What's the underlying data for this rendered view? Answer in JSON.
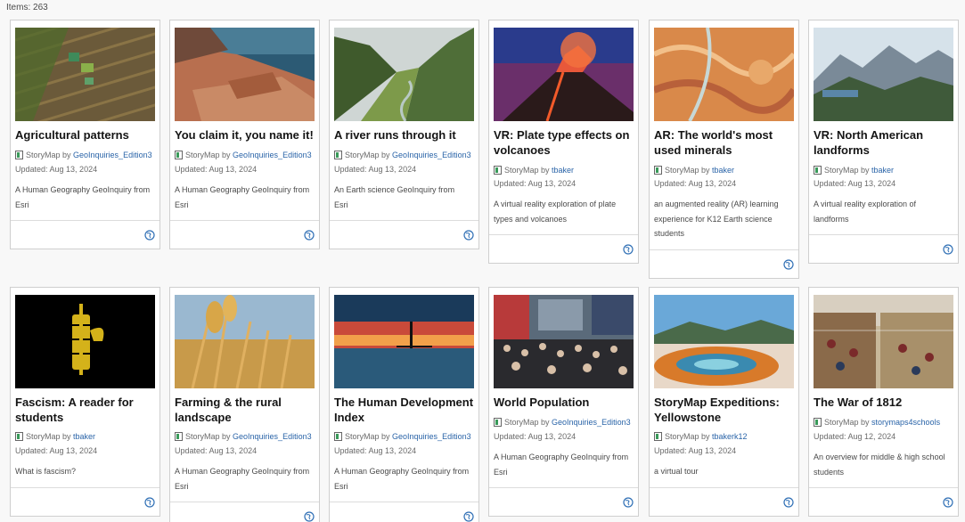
{
  "header": {
    "items_count": "Items: 263"
  },
  "labels": {
    "type_label": "StoryMap by "
  },
  "icons": {
    "storymap": "storymap-icon",
    "share": "globe-share-icon"
  },
  "colors": {
    "owner_link": "#2a64a8",
    "card_border": "#cfcfcf",
    "share_icon": "#2f6fb5"
  },
  "cards": [
    {
      "title": "Agricultural patterns",
      "owner": "GeoInquiries_Edition3",
      "updated": "Updated: Aug 13, 2024",
      "description": "A Human Geography GeoInquiry from Esri"
    },
    {
      "title": "You claim it, you name it!",
      "owner": "GeoInquiries_Edition3",
      "updated": "Updated: Aug 13, 2024",
      "description": "A Human Geography GeoInquiry from Esri"
    },
    {
      "title": "A river runs through it",
      "owner": "GeoInquiries_Edition3",
      "updated": "Updated: Aug 13, 2024",
      "description": "An Earth science GeoInquiry from Esri"
    },
    {
      "title": "VR: Plate type effects on volcanoes",
      "owner": "tbaker",
      "updated": "Updated: Aug 13, 2024",
      "description": "A virtual reality exploration of plate types and volcanoes"
    },
    {
      "title": "AR: The world's most used minerals",
      "owner": "tbaker",
      "updated": "Updated: Aug 13, 2024",
      "description": "an augmented reality (AR) learning experience for K12 Earth science students"
    },
    {
      "title": "VR: North American landforms",
      "owner": "tbaker",
      "updated": "Updated: Aug 13, 2024",
      "description": "A virtual reality exploration of landforms"
    },
    {
      "title": "Fascism: A reader for students",
      "owner": "tbaker",
      "updated": "Updated: Aug 13, 2024",
      "description": "What is fascism?"
    },
    {
      "title": "Farming & the rural landscape",
      "owner": "GeoInquiries_Edition3",
      "updated": "Updated: Aug 13, 2024",
      "description": "A Human Geography GeoInquiry from Esri"
    },
    {
      "title": "The Human Development Index",
      "owner": "GeoInquiries_Edition3",
      "updated": "Updated: Aug 13, 2024",
      "description": "A Human Geography GeoInquiry from Esri"
    },
    {
      "title": "World Population",
      "owner": "GeoInquiries_Edition3",
      "updated": "Updated: Aug 13, 2024",
      "description": "A Human Geography GeoInquiry from Esri"
    },
    {
      "title": "StoryMap Expeditions: Yellowstone",
      "owner": "tbakerk12",
      "updated": "Updated: Aug 13, 2024",
      "description": "a virtual tour"
    },
    {
      "title": "The War of 1812",
      "owner": "storymaps4schools",
      "updated": "Updated: Aug 12, 2024",
      "description": "An overview for middle & high school students"
    }
  ]
}
